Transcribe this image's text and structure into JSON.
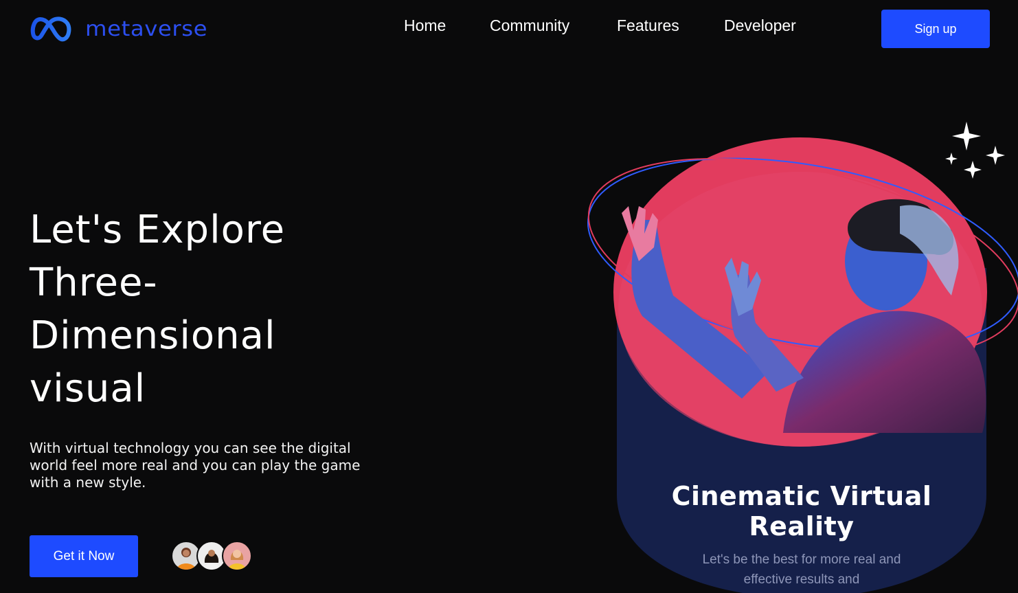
{
  "brand": {
    "name": "metaverse",
    "color": "#2c4ff0"
  },
  "nav": {
    "items": [
      {
        "label": "Home"
      },
      {
        "label": "Community"
      },
      {
        "label": "Features"
      },
      {
        "label": "Developer"
      }
    ],
    "signup_label": "Sign up"
  },
  "hero": {
    "title_lines": [
      "Let's Explore",
      "Three-",
      "Dimensional",
      "visual"
    ],
    "description": "With virtual technology you can see the digital world feel more real and you can play the game with a new style.",
    "cta_label": "Get it Now",
    "avatars": [
      "avatar-user-1",
      "avatar-user-2",
      "avatar-user-3"
    ]
  },
  "card": {
    "title_lines": [
      "Cinematic Virtual",
      "Reality"
    ],
    "subtitle": "Let's be the best for more real and effective results and"
  },
  "colors": {
    "accent": "#1e4bff",
    "background": "#0a0a0b",
    "card_navy": "#15204a",
    "disc_pink": "#e23c5e"
  },
  "icons": [
    "infinity-logo-icon",
    "sparkles-icon"
  ]
}
